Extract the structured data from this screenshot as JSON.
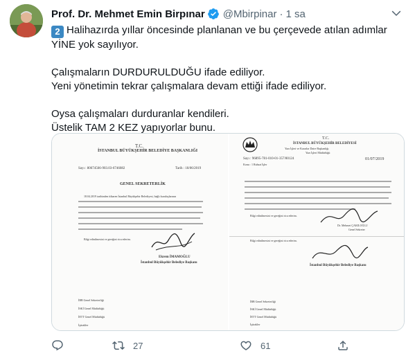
{
  "author": {
    "name": "Prof. Dr. Mehmet Emin Birpınar",
    "handle": "@Mbirpinar",
    "separator": "·",
    "time": "1 sa",
    "verified": true
  },
  "tweet": {
    "badge": "2",
    "lines": [
      "Halihazırda yıllar öncesinde planlanan ve bu çerçevede atılan adımlar",
      "YİNE yok sayılıyor.",
      "",
      "Çalışmaların DURDURULDUĞU ifade ediliyor.",
      "Yeni yönetimin tekrar çalışmalara devam ettiği ifade ediliyor.",
      "",
      "Oysa çalışmaları durduranlar kendileri.",
      "Üstelik TAM 2 KEZ yapıyorlar bunu."
    ]
  },
  "media": {
    "left_doc": {
      "tc": "T.C.",
      "institution": "İSTANBUL BÜYÜKŞEHİR BELEDİYE BAŞKANLIĞI",
      "ref": "Sayı : 80674566-903.03-6746082",
      "date": "Tarih : 18/06/2019",
      "addressee": "GENEL SEKRETERLİK",
      "body_start": "18.04.2019 tarihinden itibaren İstanbul Büyükşehir Belediyesi, bağlı kuruluşlarının",
      "closing": "Bilgi edinilmesini ve gereğini rica ederim.",
      "signer": "Ekrem İMAMOĞLU",
      "signer_title": "İstanbul Büyükşehir Belediye Başkanı",
      "distribution": [
        "İBB Genel Sekreterliği",
        "İSKİ Genel Müdürlüğü",
        "İETT Genel Müdürlüğü",
        "İştirakler"
      ]
    },
    "right_doc": {
      "tc": "T.C.",
      "institution": "İSTANBUL BÜYÜKŞEHİR BELEDİYESİ",
      "dept": "Yazı İşleri ve Kararlar Daire Başkanlığı",
      "subdept": "Yazı İşleri Müdürlüğü",
      "ref": "Sayı : 96895-781-010-01-357/80124",
      "date": "01/07/2019",
      "subject": "Konu : 1 Ruhsat İşler",
      "closing": "Bilgi edinilmesini ve gereğini rica ederim.",
      "signer": "Dr. Mehmet ÇAKILOĞLU",
      "signer_title": "Genel Sekreter",
      "closing2": "Bilgi edinilmesini ve gereğini rica ederim.",
      "signer2_title": "İstanbul Büyükşehir Belediye Başkanı",
      "distribution": [
        "İBB Genel Sekreterliği",
        "İSKİ Genel Müdürlüğü",
        "İETT Genel Müdürlüğü",
        "İştirakler"
      ]
    }
  },
  "actions": {
    "reply_count": "",
    "retweet_count": "27",
    "like_count": "61"
  },
  "colors": {
    "text": "#0f1419",
    "secondary": "#536471",
    "verified": "#1d9bf0",
    "badge": "#3b88c3",
    "border": "#cfd9de"
  }
}
